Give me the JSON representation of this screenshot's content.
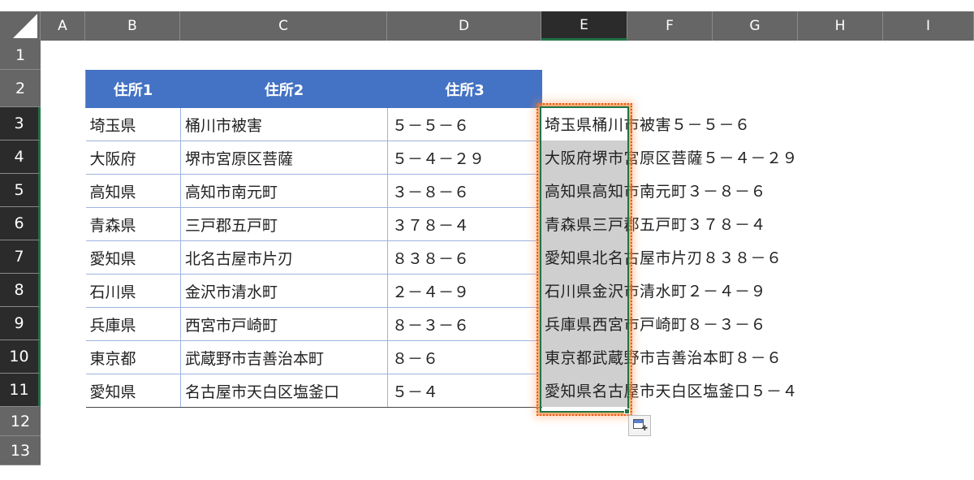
{
  "columns": [
    {
      "letter": "A",
      "w": 55
    },
    {
      "letter": "B",
      "w": 117
    },
    {
      "letter": "C",
      "w": 255
    },
    {
      "letter": "D",
      "w": 190
    },
    {
      "letter": "E",
      "w": 106,
      "active": true
    },
    {
      "letter": "F",
      "w": 105
    },
    {
      "letter": "G",
      "w": 105
    },
    {
      "letter": "H",
      "w": 105
    },
    {
      "letter": "I",
      "w": 112
    }
  ],
  "rows": [
    "1",
    "2",
    "3",
    "4",
    "5",
    "6",
    "7",
    "8",
    "9",
    "10",
    "11",
    "12",
    "13"
  ],
  "table": {
    "headers": [
      "住所1",
      "住所2",
      "住所3"
    ],
    "data": [
      [
        "埼玉県",
        "桶川市被害",
        "５－５－６"
      ],
      [
        "大阪府",
        "堺市宮原区菩薩",
        "５－４－２９"
      ],
      [
        "高知県",
        "高知市南元町",
        "３－８－６"
      ],
      [
        "青森県",
        "三戸郡五戸町",
        "３７８－４"
      ],
      [
        "愛知県",
        "北名古屋市片刃",
        "８３８－６"
      ],
      [
        "石川県",
        "金沢市清水町",
        "２－４－９"
      ],
      [
        "兵庫県",
        "西宮市戸崎町",
        "８－３－６"
      ],
      [
        "東京都",
        "武蔵野市吉善治本町",
        "８－６"
      ],
      [
        "愛知県",
        "名古屋市天白区塩釜口",
        "５－４"
      ]
    ]
  },
  "combined": [
    "埼玉県桶川市被害５－５－６",
    "大阪府堺市宮原区菩薩５－４－２９",
    "高知県高知市南元町３－８－６",
    "青森県三戸郡五戸町３７８－４",
    "愛知県北名古屋市片刃８３８－６",
    "石川県金沢市清水町２－４－９",
    "兵庫県西宮市戸崎町８－３－６",
    "東京都武蔵野市吉善治本町８－６",
    "愛知県名古屋市天白区塩釜口５－４"
  ]
}
